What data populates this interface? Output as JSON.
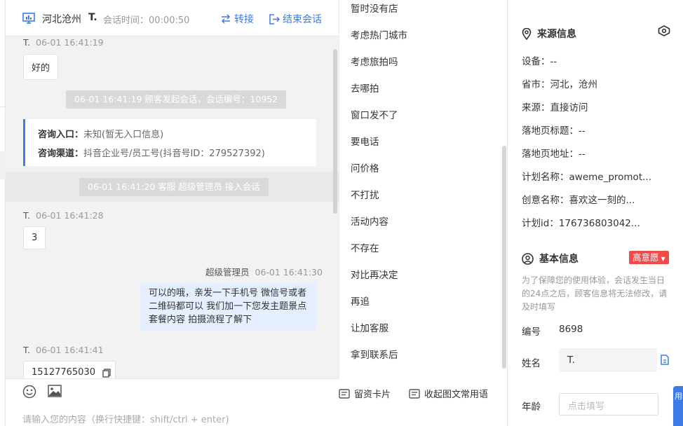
{
  "header": {
    "location": "河北沧州",
    "user": "T.",
    "session_time": "会话时间：00:00:50",
    "transfer_label": "转接",
    "end_label": "结束会话"
  },
  "messages": {
    "m1": {
      "name": "T.",
      "time": "06-01 16:41:19",
      "text": "好的"
    },
    "sys1": "06-01 16:41:19 顾客发起会话，会话编号：10952",
    "entry": {
      "label": "咨询入口：",
      "value": "未知(暂无入口信息)"
    },
    "channel": {
      "label": "咨询渠道：",
      "value": "抖音企业号/员工号(抖音号ID：279527392)"
    },
    "sys2": "06-01 16:41:20 客服 超级管理员 接入会话",
    "m2": {
      "name": "T.",
      "time": "06-01 16:41:28",
      "text": "3"
    },
    "agent": {
      "name": "超级管理员",
      "time": "06-01 16:41:30",
      "text": "可以的哦，亲发一下手机号 微信号或者二维码都可以 我们加一下您发主题景点套餐内容 拍摄流程了解下"
    },
    "m3": {
      "name": "T.",
      "time": "06-01 16:41:41",
      "text": "15127765030"
    }
  },
  "composer": {
    "placeholder": "请输入您的内容（换行快捷键：shift/ctrl + enter)"
  },
  "phrases": [
    "暂时没有店",
    "考虑热门城市",
    "考虑旅拍吗",
    "去哪拍",
    "窗口发不了",
    "要电话",
    "问价格",
    "不打扰",
    "活动内容",
    "不存在",
    "对比再决定",
    "再追",
    "让加客服",
    "拿到联系后"
  ],
  "tools": {
    "card": "留资卡片",
    "collapse": "收起图文常用语"
  },
  "source": {
    "title": "来源信息",
    "device": "设备：--",
    "province": "省市：河北，沧州",
    "origin": "来源：直接访问",
    "landing_title": "落地页标题：--",
    "landing_url": "落地页地址：--",
    "plan_name": "计划名称：aweme_promot...",
    "creative_name": "创意名称：喜欢这一刻的...",
    "plan_id": "计划id：176736803042..."
  },
  "basic": {
    "title": "基本信息",
    "intent_badge": "高意愿",
    "note": "为了保障您的使用体验，会话发生当日的24点之后，顾客信息将无法修改，请及时填写",
    "id_label": "编号",
    "id_value": "8698",
    "name_label": "姓名",
    "name_value": "T.",
    "age_label": "年龄",
    "age_placeholder": "点击填写"
  },
  "corner_tab": "用",
  "colors": {
    "accent": "#3b7ce8",
    "badge": "#f14b4b",
    "agent_bubble": "#e6efff"
  }
}
